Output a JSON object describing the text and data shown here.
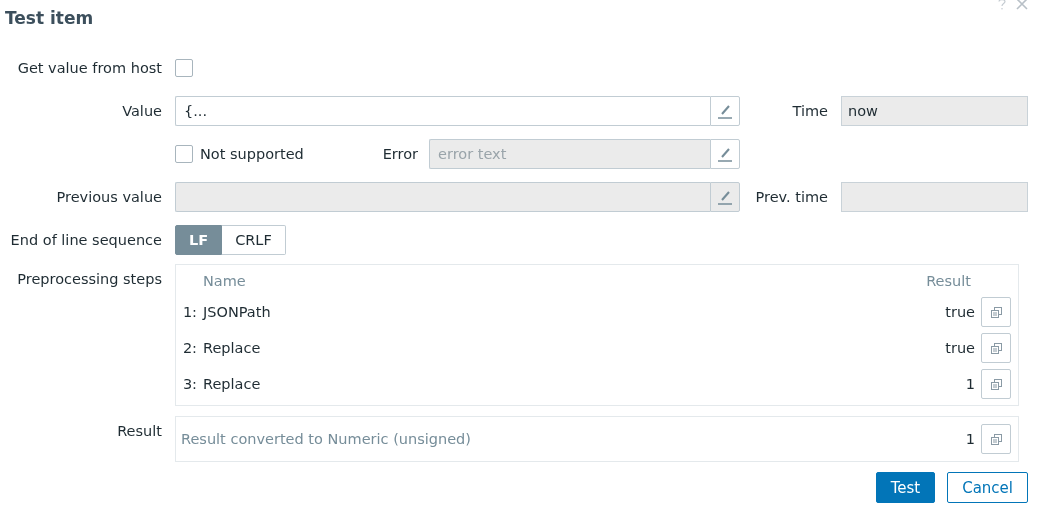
{
  "dialog": {
    "title": "Test item"
  },
  "get_value_from_host": {
    "label": "Get value from host",
    "checked": false
  },
  "value": {
    "label": "Value",
    "value": "{..."
  },
  "time": {
    "label": "Time",
    "value": "now"
  },
  "not_supported": {
    "label": "Not supported",
    "checked": false
  },
  "error": {
    "label": "Error",
    "placeholder": "error text"
  },
  "previous_value": {
    "label": "Previous value"
  },
  "prev_time": {
    "label": "Prev. time"
  },
  "eol": {
    "label": "End of line sequence",
    "options": [
      {
        "label": "LF",
        "selected": true
      },
      {
        "label": "CRLF",
        "selected": false
      }
    ]
  },
  "preprocessing": {
    "label": "Preprocessing steps",
    "columns": [
      "Name",
      "Result"
    ],
    "steps": [
      {
        "number": "1:",
        "name": "JSONPath",
        "result": "true"
      },
      {
        "number": "2:",
        "name": "Replace",
        "result": "true"
      },
      {
        "number": "3:",
        "name": "Replace",
        "result": "1"
      }
    ]
  },
  "result": {
    "label": "Result",
    "text": "Result converted to Numeric (unsigned)",
    "value": "1"
  },
  "buttons": [
    {
      "label": "Test",
      "kind": "primary"
    },
    {
      "label": "Cancel",
      "kind": "secondary"
    }
  ]
}
